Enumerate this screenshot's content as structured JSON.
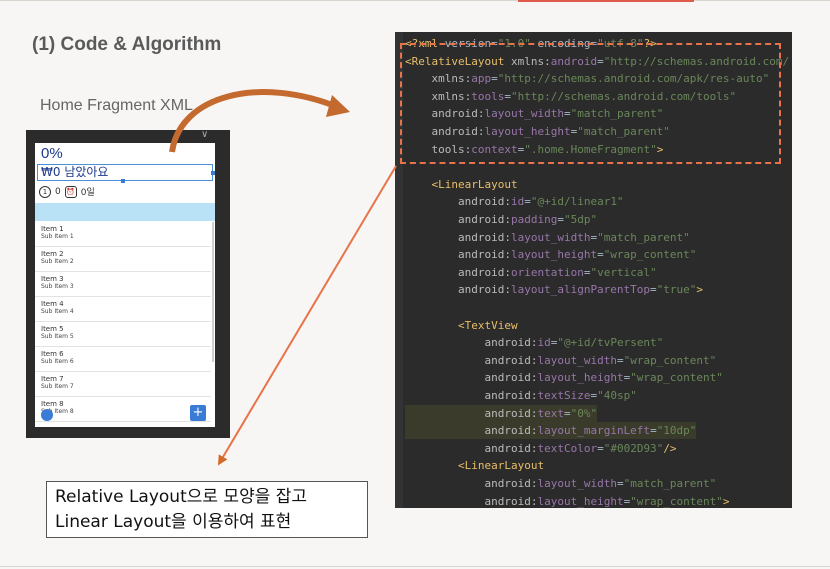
{
  "slide": {
    "title": "(1) Code & Algorithm",
    "subtitle": "Home Fragment XML"
  },
  "phone": {
    "percent": "0%",
    "remaining": "₩0 남았아요",
    "stat_count": "0",
    "stat_days": "0일",
    "items": [
      {
        "title": "Item 1",
        "sub": "Sub Item 1"
      },
      {
        "title": "Item 2",
        "sub": "Sub Item 2"
      },
      {
        "title": "Item 3",
        "sub": "Sub Item 3"
      },
      {
        "title": "Item 4",
        "sub": "Sub Item 4"
      },
      {
        "title": "Item 5",
        "sub": "Sub Item 5"
      },
      {
        "title": "Item 6",
        "sub": "Sub Item 6"
      },
      {
        "title": "Item 7",
        "sub": "Sub Item 7"
      },
      {
        "title": "Item 8",
        "sub": "Sub Item 8"
      }
    ],
    "add_icon": "add-box-icon"
  },
  "code": {
    "lines": [
      "<?xml version=\"1.0\" encoding=\"utf-8\"?>",
      "<RelativeLayout xmlns:android=\"http://schemas.android.com/",
      "    xmlns:app=\"http://schemas.android.com/apk/res-auto\"",
      "    xmlns:tools=\"http://schemas.android.com/tools\"",
      "    android:layout_width=\"match_parent\"",
      "    android:layout_height=\"match_parent\"",
      "    tools:context=\".home.HomeFragment\">",
      "",
      "    <LinearLayout",
      "        android:id=\"@+id/linear1\"",
      "        android:padding=\"5dp\"",
      "        android:layout_width=\"match_parent\"",
      "        android:layout_height=\"wrap_content\"",
      "        android:orientation=\"vertical\"",
      "        android:layout_alignParentTop=\"true\">",
      "",
      "        <TextView",
      "            android:id=\"@+id/tvPersent\"",
      "            android:layout_width=\"wrap_content\"",
      "            android:layout_height=\"wrap_content\"",
      "            android:textSize=\"40sp\"",
      "            android:text=\"0%\"",
      "            android:layout_marginLeft=\"10dp\"",
      "            android:textColor=\"#002D93\"/>",
      "        <LinearLayout",
      "            android:layout_width=\"match_parent\"",
      "            android:layout_height=\"wrap_content\">"
    ]
  },
  "note": {
    "line1": "Relative Layout으로 모양을 잡고",
    "line2": "Linear Layout을 이용하여  표현"
  },
  "colors": {
    "accent_orange": "#e8734a",
    "text_blue": "#1d3a8a"
  }
}
